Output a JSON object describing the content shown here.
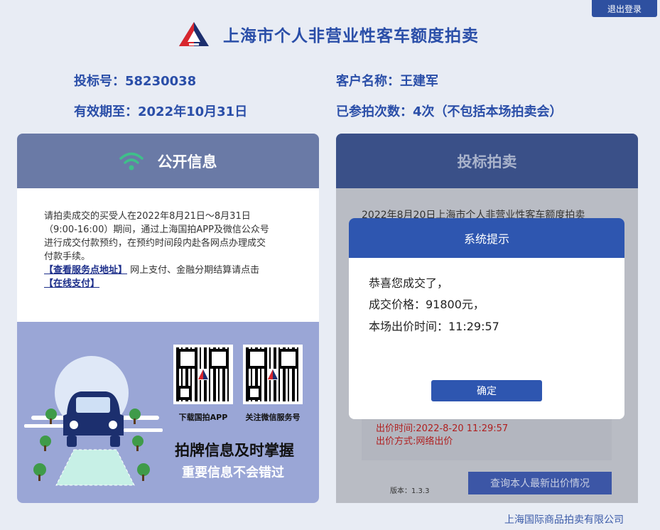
{
  "header": {
    "logout_label": "退出登录",
    "title": "上海市个人非营业性客车额度拍卖",
    "logo_icon": "auction-logo-icon"
  },
  "account": {
    "bid_no_label": "投标号：",
    "bid_no": "58230038",
    "customer_label": "客户名称：",
    "customer_name": "王建军",
    "valid_label": "有效期至：",
    "valid_until": "2022年10月31日",
    "count_label": "已参拍次数：",
    "count_value": "4次（不包括本场拍卖会）"
  },
  "public_info": {
    "title": "公开信息",
    "icon": "wifi-icon",
    "notice_line1": "请拍卖成交的买受人在2022年8月21日～8月31日",
    "notice_line2": "（9:00-16:00）期间，通过上海国拍APP及微信公众号",
    "notice_line3": "进行成交付款预约，在预约时间段内赴各网点办理成交",
    "notice_line4": "付款手续。",
    "service_link": "【查看服务点地址】",
    "notice_line5": "网上支付、金融分期结算请点击",
    "pay_link": "【在线支付】",
    "qr_app_caption": "下载国拍APP",
    "qr_wechat_caption": "关注微信服务号",
    "slogan_main": "拍牌信息及时掌握",
    "slogan_sub": "重要信息不会错过"
  },
  "auction": {
    "title": "投标拍卖",
    "auction_name": "2022年8月20日上海市个人非营业性客车额度拍卖",
    "bid_time": "出价时间:2022-8-20 11:29:57",
    "bid_method": "出价方式:网络出价",
    "version": "版本：1.3.3",
    "query_button": "查询本人最新出价情况"
  },
  "dialog": {
    "title": "系统提示",
    "line1": "恭喜您成交了，",
    "line2": "成交价格：91800元，",
    "line3": "本场出价时间：11:29:57",
    "confirm": "确定"
  },
  "footer": {
    "company": "上海国际商品拍卖有限公司"
  },
  "colors": {
    "brand_blue": "#2a4ea8",
    "dialog_blue": "#2e56b0",
    "bg": "#e8ecf4",
    "bid_red": "#b02020",
    "wifi_green": "#3fbf8a"
  }
}
